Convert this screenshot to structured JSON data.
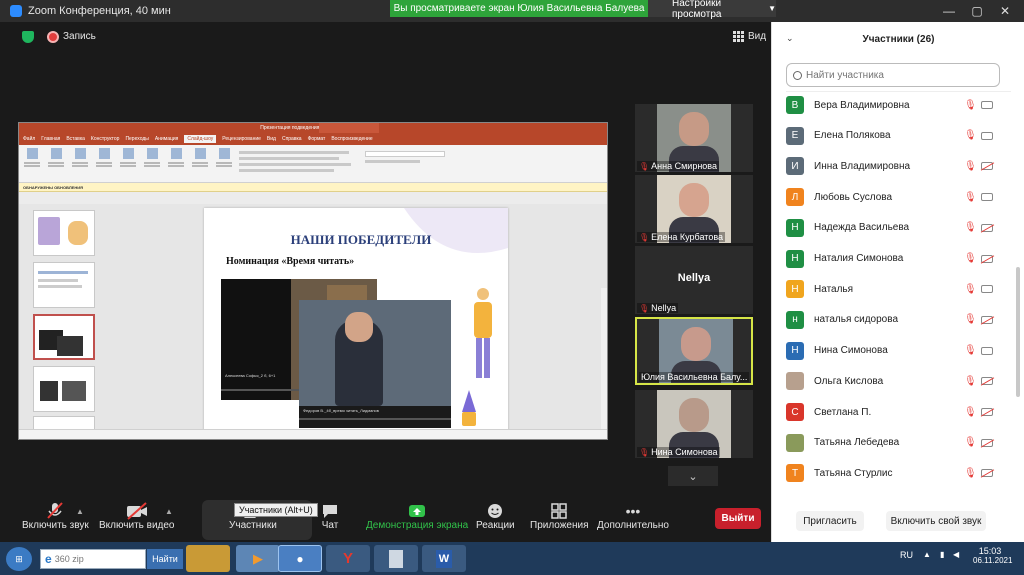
{
  "window": {
    "title": "Zoom Конференция, 40 мин",
    "share_banner": "Вы просматриваете экран Юлия Васильевна Балуева",
    "view_settings": "Настройки просмотра",
    "minimize": "—",
    "maximize": "▢",
    "close": "✕"
  },
  "meeting_top": {
    "recording_label": "Запись",
    "view_label": "Вид"
  },
  "shared_screen": {
    "slide_title": "НАШИ ПОБЕДИТЕЛИ",
    "slide_subtitle": "Номинация «Время читать»",
    "video1_caption": "Алексеева Софья_2 б, 6+1",
    "video2_caption": "Федоров В._4б_время читать_Лидманов",
    "ppt_doc_title": "Презентация подведения итогов - PowerPoint",
    "update_bar": "ОБНАРУЖЕНЫ ОБНОВЛЕНИЯ",
    "ppt_tabs": [
      "Файл",
      "Главная",
      "Вставка",
      "Конструктор",
      "Переходы",
      "Анимация",
      "Слайд-шоу",
      "Рецензирование",
      "Вид",
      "Справка",
      "Формат",
      "Воспроизведение"
    ],
    "ppt_active_tab": "Слайд-шоу"
  },
  "gallery": [
    {
      "name": "Анна Смирнова",
      "muted": true,
      "face": "#c69a86",
      "bg": "#8a8f8a"
    },
    {
      "name": "Елена Курбатова",
      "muted": true,
      "face": "#d6a48f",
      "bg": "#d9d2c4"
    },
    {
      "name": "Nellya",
      "muted": true,
      "text": "Nellya"
    },
    {
      "name": "Юлия Васильевна Балу...",
      "muted": false,
      "face": "#c79a8c",
      "bg": "#7b8a95",
      "active": true
    },
    {
      "name": "Нина Симонова",
      "muted": true,
      "face": "#b89a8a",
      "bg": "#c9c6bd"
    }
  ],
  "gallery_more": "⌄",
  "toolbar": {
    "unmute": "Включить звук",
    "start_video": "Включить видео",
    "participants": "Участники",
    "participants_tooltip": "Участники (Alt+U)",
    "chat": "Чат",
    "share_screen": "Демонстрация экрана",
    "reactions": "Реакции",
    "apps": "Приложения",
    "more": "Дополнительно",
    "leave": "Выйти"
  },
  "participants_panel": {
    "title": "Участники (26)",
    "search_placeholder": "Найти участника",
    "invite": "Пригласить",
    "unmute_self": "Включить свой звук",
    "items": [
      {
        "initial": "В",
        "name": "Вера Владимировна",
        "color": "#1f8f44",
        "cam_off": false
      },
      {
        "initial": "Е",
        "name": "Елена Полякова",
        "color": "#5c6b78",
        "cam_off": false
      },
      {
        "initial": "И",
        "name": "Инна Владимировна",
        "color": "#5c6b78",
        "cam_off": true
      },
      {
        "initial": "Л",
        "name": "Любовь Суслова",
        "color": "#f0831e",
        "cam_off": false
      },
      {
        "initial": "Н",
        "name": "Надежда Васильева",
        "color": "#1f8f44",
        "cam_off": true
      },
      {
        "initial": "Н",
        "name": "Наталия Симонова",
        "color": "#1f8f44",
        "cam_off": true
      },
      {
        "initial": "Н",
        "name": "Наталья",
        "color": "#f0a51e",
        "cam_off": false
      },
      {
        "initial": "н",
        "name": "наталья сидорова",
        "color": "#1f8f44",
        "cam_off": true
      },
      {
        "initial": "Н",
        "name": "Нина Симонова",
        "color": "#2b6cb3",
        "cam_off": false
      },
      {
        "initial": "",
        "name": "Ольга Кислова",
        "color": "#b7a08e",
        "cam_off": true
      },
      {
        "initial": "С",
        "name": "Светлана П.",
        "color": "#d9362b",
        "cam_off": true
      },
      {
        "initial": "",
        "name": "Татьяна Лебедева",
        "color": "#8a9a5b",
        "cam_off": true
      },
      {
        "initial": "Т",
        "name": "Татьяна Стурлис",
        "color": "#f0831e",
        "cam_off": true
      }
    ]
  },
  "taskbar": {
    "search_placeholder": "360 zip",
    "find": "Найти",
    "lang": "RU",
    "time": "15:03",
    "date": "06.11.2021"
  }
}
